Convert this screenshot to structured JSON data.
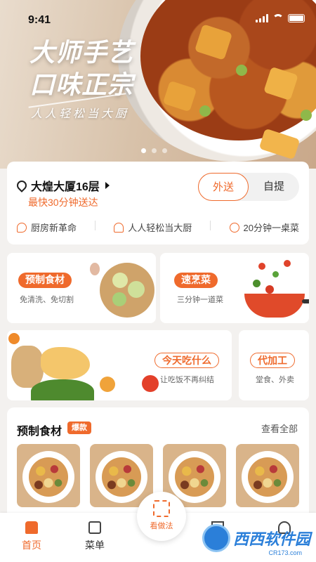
{
  "status_bar": {
    "time": "9:41"
  },
  "banner": {
    "title_line1": "大师手艺",
    "title_line2": "口味正宗",
    "subtitle": "人人轻松当大厨",
    "carousel_active": 1,
    "carousel_total": 3
  },
  "location": {
    "address": "大煌大厦16层",
    "eta": "最快30分钟送达",
    "mode_options": [
      "外送",
      "自提"
    ],
    "mode_selected": "外送"
  },
  "features": [
    {
      "icon": "chat-icon",
      "label": "厨房新革命"
    },
    {
      "icon": "chef-hat-icon",
      "label": "人人轻松当大厨"
    },
    {
      "icon": "clock-icon",
      "label": "20分钟一桌菜"
    }
  ],
  "categories": {
    "prepared": {
      "title": "预制食材",
      "desc": "免清洗、免切割"
    },
    "quick": {
      "title": "速烹菜",
      "desc": "三分钟一道菜"
    },
    "today": {
      "title": "今天吃什么",
      "desc": "让吃饭不再纠结"
    },
    "processing": {
      "title": "代加工",
      "desc": "堂食、外卖"
    }
  },
  "prepared_section": {
    "title": "预制食材",
    "badge": "爆款",
    "view_all": "查看全部"
  },
  "bottom_nav": {
    "items": [
      {
        "label": "首页",
        "icon": "home-icon",
        "active": true
      },
      {
        "label": "菜单",
        "icon": "menu-book-icon",
        "active": false
      }
    ],
    "scan_label": "看做法"
  },
  "watermark": {
    "text": "西西软件园",
    "sub": "CR173.com"
  },
  "colors": {
    "accent": "#ef6a2c"
  }
}
